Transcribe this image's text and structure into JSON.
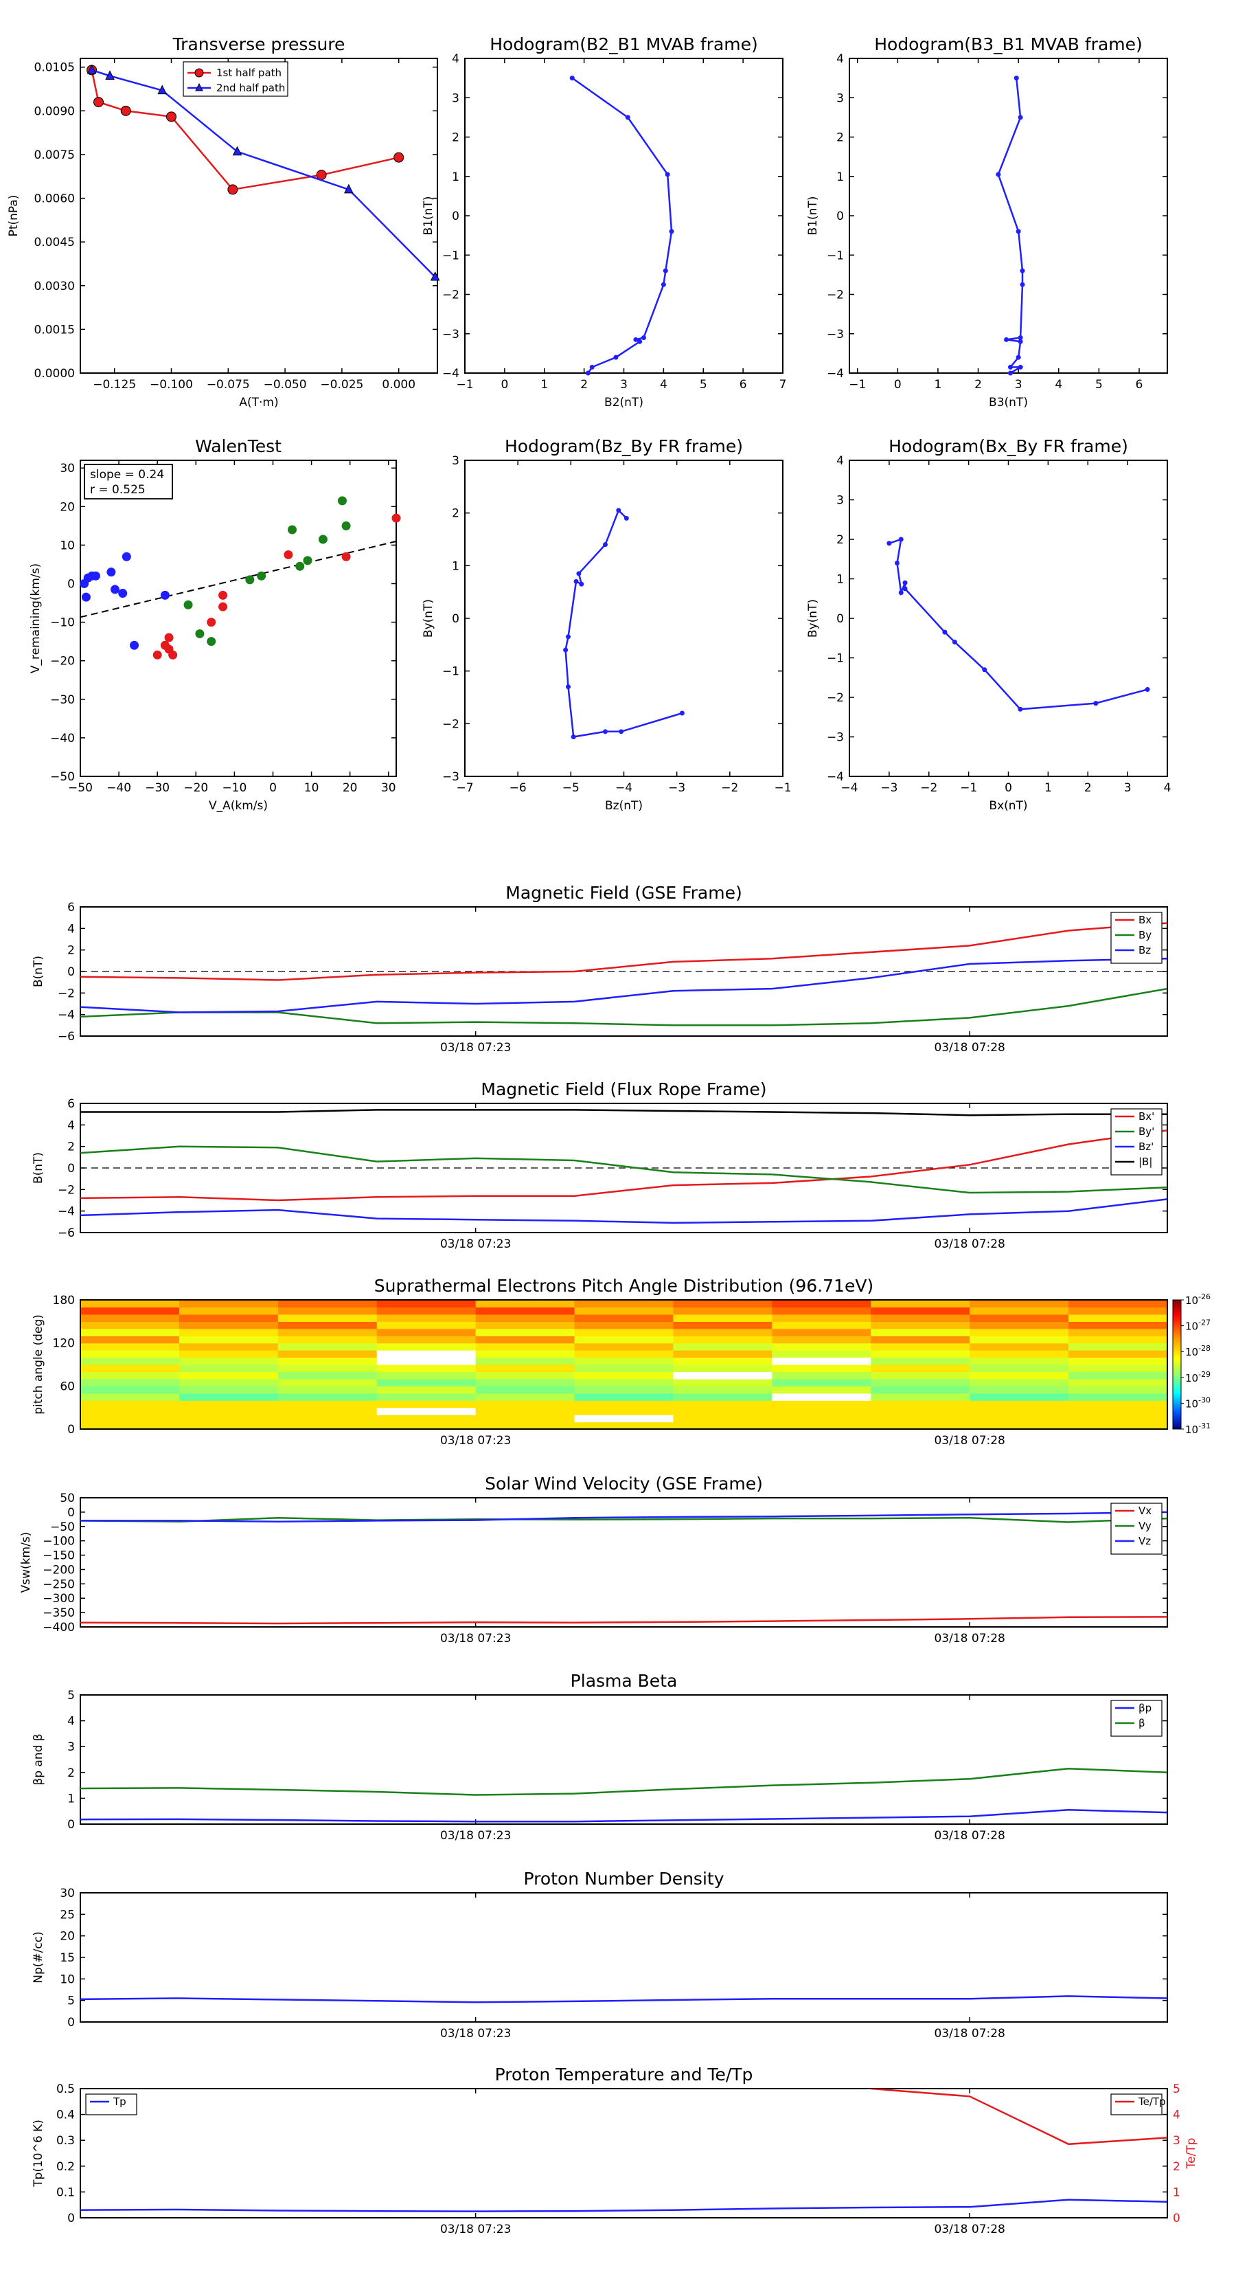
{
  "chart_data": [
    {
      "id": "transverse_pressure",
      "type": "line",
      "title": "Transverse pressure",
      "xlabel": "A(T·m)",
      "ylabel": "Pt(nPa)",
      "xlim": [
        -0.14,
        0.017
      ],
      "ylim": [
        0,
        0.0108
      ],
      "xticks": [
        -0.125,
        -0.1,
        -0.075,
        -0.05,
        -0.025,
        0.0
      ],
      "xticklabels": [
        "−0.125",
        "−0.100",
        "−0.075",
        "−0.050",
        "−0.025",
        "0.000"
      ],
      "yticks": [
        0,
        0.0015,
        0.003,
        0.0045,
        0.006,
        0.0075,
        0.009,
        0.0105
      ],
      "yticklabels": [
        "0.0000",
        "0.0015",
        "0.0030",
        "0.0045",
        "0.0060",
        "0.0075",
        "0.0090",
        "0.0105"
      ],
      "legend": "top-center",
      "series": [
        {
          "name": "1st half path",
          "color": "#e41a1c",
          "marker": "circle",
          "x": [
            -0.135,
            -0.132,
            -0.12,
            -0.1,
            -0.073,
            -0.034,
            0.0
          ],
          "y": [
            0.0104,
            0.0093,
            0.009,
            0.0088,
            0.0063,
            0.0068,
            0.0074
          ]
        },
        {
          "name": "2nd half path",
          "color": "#1f1fff",
          "marker": "triangle",
          "x": [
            -0.135,
            -0.127,
            -0.104,
            -0.071,
            -0.022,
            0.016
          ],
          "y": [
            0.0104,
            0.0102,
            0.0097,
            0.0076,
            0.0063,
            0.0033
          ]
        }
      ]
    },
    {
      "id": "hodogram_b2_b1",
      "type": "line",
      "title": "Hodogram(B2_B1 MVAB frame)",
      "xlabel": "B2(nT)",
      "ylabel": "B1(nT)",
      "xlim": [
        -1,
        7
      ],
      "ylim": [
        -4,
        4
      ],
      "xticks": [
        -1,
        0,
        1,
        2,
        3,
        4,
        5,
        6,
        7
      ],
      "yticks": [
        -4,
        -3,
        -2,
        -1,
        0,
        1,
        2,
        3,
        4
      ],
      "series": [
        {
          "color": "#1f1fff",
          "x": [
            1.7,
            3.1,
            4.1,
            4.2,
            4.05,
            4.0,
            3.5,
            3.3,
            3.4,
            2.8,
            2.2,
            2.1
          ],
          "y": [
            3.5,
            2.5,
            1.05,
            -0.4,
            -1.4,
            -1.75,
            -3.1,
            -3.15,
            -3.2,
            -3.6,
            -3.85,
            -4.0
          ]
        }
      ]
    },
    {
      "id": "hodogram_b3_b1",
      "type": "line",
      "title": "Hodogram(B3_B1 MVAB frame)",
      "xlabel": "B3(nT)",
      "ylabel": "B1(nT)",
      "xlim": [
        -1.2,
        6.7
      ],
      "ylim": [
        -4,
        4
      ],
      "xticks": [
        -1,
        0,
        1,
        2,
        3,
        4,
        5,
        6
      ],
      "yticks": [
        -4,
        -3,
        -2,
        -1,
        0,
        1,
        2,
        3,
        4
      ],
      "series": [
        {
          "color": "#1f1fff",
          "x": [
            2.95,
            3.05,
            2.5,
            3.0,
            3.1,
            3.1,
            3.05,
            2.7,
            3.05,
            3.0,
            2.8,
            3.05,
            2.8
          ],
          "y": [
            3.5,
            2.5,
            1.05,
            -0.4,
            -1.4,
            -1.75,
            -3.1,
            -3.15,
            -3.2,
            -3.6,
            -3.85,
            -3.85,
            -4.0
          ]
        }
      ]
    },
    {
      "id": "walen_test",
      "type": "scatter",
      "title": "WalenTest",
      "xlabel": "V_A(km/s)",
      "ylabel": "V_remaining(km/s)",
      "xlim": [
        -50,
        32
      ],
      "ylim": [
        -50,
        32
      ],
      "xticks": [
        -50,
        -40,
        -30,
        -20,
        -10,
        0,
        10,
        20,
        30
      ],
      "yticks": [
        -50,
        -40,
        -30,
        -20,
        -10,
        0,
        10,
        20,
        30
      ],
      "annotation": [
        "slope = 0.24",
        "r = 0.525"
      ],
      "fit": {
        "slope": 0.24,
        "intercept": 3.3
      },
      "series": [
        {
          "color": "#1f1fff",
          "x": [
            -49,
            -48,
            -47,
            -46,
            -48.5,
            -42,
            -41,
            -38,
            -39,
            -36,
            -28
          ],
          "y": [
            0,
            1.5,
            2,
            2,
            -3.5,
            3,
            -1.5,
            7,
            -2.5,
            -16,
            -3
          ]
        },
        {
          "color": "#e41a1c",
          "x": [
            -30,
            -28,
            -27,
            -27,
            -26,
            -16,
            -13,
            -13,
            4,
            19,
            32
          ],
          "y": [
            -18.5,
            -16,
            -14,
            -17,
            -18.5,
            -10,
            -6,
            -3,
            7.5,
            7,
            17
          ]
        },
        {
          "color": "#1a801a",
          "x": [
            -22,
            -19,
            -16,
            -6,
            -3,
            5,
            7,
            9,
            13,
            18,
            19
          ],
          "y": [
            -5.5,
            -13,
            -15,
            1,
            2,
            14,
            4.5,
            6,
            11.5,
            21.5,
            15
          ]
        }
      ]
    },
    {
      "id": "hodogram_bz_by",
      "type": "line",
      "title": "Hodogram(Bz_By FR frame)",
      "xlabel": "Bz(nT)",
      "ylabel": "By(nT)",
      "xlim": [
        -7,
        -1
      ],
      "ylim": [
        -3,
        3
      ],
      "xticks": [
        -7,
        -6,
        -5,
        -4,
        -3,
        -2,
        -1
      ],
      "yticks": [
        -3,
        -2,
        -1,
        0,
        1,
        2,
        3
      ],
      "series": [
        {
          "color": "#1f1fff",
          "x": [
            -3.95,
            -4.1,
            -4.35,
            -4.85,
            -4.8,
            -4.9,
            -5.05,
            -5.1,
            -5.05,
            -4.95,
            -4.35,
            -4.05,
            -2.9
          ],
          "y": [
            1.9,
            2.05,
            1.4,
            0.85,
            0.65,
            0.7,
            -0.35,
            -0.6,
            -1.3,
            -2.25,
            -2.15,
            -2.15,
            -1.8
          ]
        }
      ]
    },
    {
      "id": "hodogram_bx_by",
      "type": "line",
      "title": "Hodogram(Bx_By FR frame)",
      "xlabel": "Bx(nT)",
      "ylabel": "By(nT)",
      "xlim": [
        -4,
        4
      ],
      "ylim": [
        -4,
        4
      ],
      "xticks": [
        -4,
        -3,
        -2,
        -1,
        0,
        1,
        2,
        3,
        4
      ],
      "yticks": [
        -4,
        -3,
        -2,
        -1,
        0,
        1,
        2,
        3,
        4
      ],
      "series": [
        {
          "color": "#1f1fff",
          "x": [
            -3.0,
            -2.7,
            -2.8,
            -2.7,
            -2.6,
            -2.6,
            -1.6,
            -1.35,
            -0.6,
            0.3,
            2.2,
            3.5
          ],
          "y": [
            1.9,
            2.0,
            1.4,
            0.65,
            0.9,
            0.75,
            -0.35,
            -0.6,
            -1.3,
            -2.3,
            -2.15,
            -1.8
          ]
        }
      ]
    },
    {
      "id": "mag_gse",
      "type": "line",
      "title": "Magnetic Field (GSE Frame)",
      "ylabel": "B(nT)",
      "xlim": [
        0,
        11
      ],
      "ylim": [
        -6,
        6
      ],
      "yticks": [
        -6,
        -4,
        -2,
        0,
        2,
        4,
        6
      ],
      "xtick_positions": [
        4,
        9
      ],
      "xticklabels": [
        "03/18 07:23",
        "03/18 07:28"
      ],
      "zero_line": true,
      "legend": "top-right",
      "x": [
        0,
        1,
        2,
        3,
        4,
        5,
        6,
        7,
        8,
        9,
        10,
        11
      ],
      "series": [
        {
          "name": "Bx",
          "color": "#e41a1c",
          "values": [
            -0.5,
            -0.6,
            -0.8,
            -0.3,
            -0.1,
            0.0,
            0.9,
            1.2,
            1.8,
            2.4,
            3.8,
            4.5
          ]
        },
        {
          "name": "By",
          "color": "#1a801a",
          "values": [
            -4.2,
            -3.8,
            -3.8,
            -4.8,
            -4.7,
            -4.8,
            -5.0,
            -5.0,
            -4.8,
            -4.3,
            -3.2,
            -1.6
          ]
        },
        {
          "name": "Bz",
          "color": "#1f1fff",
          "values": [
            -3.3,
            -3.8,
            -3.7,
            -2.8,
            -3.0,
            -2.8,
            -1.8,
            -1.6,
            -0.6,
            0.7,
            1.0,
            1.2
          ]
        }
      ]
    },
    {
      "id": "mag_fr",
      "type": "line",
      "title": "Magnetic Field (Flux Rope Frame)",
      "ylabel": "B(nT)",
      "xlim": [
        0,
        11
      ],
      "ylim": [
        -6,
        6
      ],
      "yticks": [
        -6,
        -4,
        -2,
        0,
        2,
        4,
        6
      ],
      "xtick_positions": [
        4,
        9
      ],
      "xticklabels": [
        "03/18 07:23",
        "03/18 07:28"
      ],
      "zero_line": true,
      "legend": "top-right",
      "x": [
        0,
        1,
        2,
        3,
        4,
        5,
        6,
        7,
        8,
        9,
        10,
        11
      ],
      "series": [
        {
          "name": "Bx'",
          "color": "#e41a1c",
          "values": [
            -2.8,
            -2.7,
            -3.0,
            -2.7,
            -2.6,
            -2.6,
            -1.6,
            -1.4,
            -0.8,
            0.3,
            2.2,
            3.5
          ]
        },
        {
          "name": "By'",
          "color": "#1a801a",
          "values": [
            1.4,
            2.0,
            1.9,
            0.6,
            0.9,
            0.7,
            -0.4,
            -0.6,
            -1.3,
            -2.3,
            -2.2,
            -1.8
          ]
        },
        {
          "name": "Bz'",
          "color": "#1f1fff",
          "values": [
            -4.4,
            -4.1,
            -3.9,
            -4.7,
            -4.8,
            -4.9,
            -5.1,
            -5.0,
            -4.9,
            -4.3,
            -4.0,
            -2.9
          ]
        },
        {
          "name": "|B|",
          "color": "#000000",
          "values": [
            5.2,
            5.2,
            5.2,
            5.4,
            5.4,
            5.4,
            5.3,
            5.2,
            5.1,
            4.9,
            5.0,
            5.0
          ]
        }
      ]
    },
    {
      "id": "pad",
      "type": "heatmap",
      "title": "Suprathermal Electrons Pitch Angle Distribution (96.71eV)",
      "ylabel": "pitch angle (deg)",
      "xlim": [
        0,
        11
      ],
      "ylim": [
        0,
        180
      ],
      "yticks": [
        0,
        60,
        120,
        180
      ],
      "xtick_positions": [
        4,
        9
      ],
      "xticklabels": [
        "03/18 07:23",
        "03/18 07:28"
      ],
      "colorbar_ticks": [
        "10-26",
        "10-27",
        "10-28",
        "10-29",
        "10-30",
        "10-31"
      ],
      "colorbar_range_log10": [
        -31,
        -26
      ],
      "columns": 11,
      "rows": 18
    },
    {
      "id": "sw_velocity",
      "type": "line",
      "title": "Solar Wind Velocity (GSE Frame)",
      "ylabel": "Vsw(km/s)",
      "xlim": [
        0,
        11
      ],
      "ylim": [
        -400,
        50
      ],
      "yticks": [
        -400,
        -350,
        -300,
        -250,
        -200,
        -150,
        -100,
        -50,
        0,
        50
      ],
      "xtick_positions": [
        4,
        9
      ],
      "xticklabels": [
        "03/18 07:23",
        "03/18 07:28"
      ],
      "legend": "top-right",
      "x": [
        0,
        1,
        2,
        3,
        4,
        5,
        6,
        7,
        8,
        9,
        10,
        11
      ],
      "series": [
        {
          "name": "Vx",
          "color": "#e41a1c",
          "values": [
            -385,
            -386,
            -388,
            -386,
            -384,
            -385,
            -383,
            -380,
            -376,
            -372,
            -366,
            -365
          ]
        },
        {
          "name": "Vy",
          "color": "#1a801a",
          "values": [
            -30,
            -33,
            -20,
            -28,
            -25,
            -26,
            -25,
            -22,
            -22,
            -20,
            -35,
            -22
          ]
        },
        {
          "name": "Vz",
          "color": "#1f1fff",
          "values": [
            -30,
            -30,
            -33,
            -30,
            -28,
            -20,
            -17,
            -15,
            -12,
            -8,
            -5,
            0
          ]
        }
      ]
    },
    {
      "id": "plasma_beta",
      "type": "line",
      "title": "Plasma Beta",
      "ylabel": "βp and β",
      "xlim": [
        0,
        11
      ],
      "ylim": [
        0,
        5
      ],
      "yticks": [
        0,
        1,
        2,
        3,
        4,
        5
      ],
      "xtick_positions": [
        4,
        9
      ],
      "xticklabels": [
        "03/18 07:23",
        "03/18 07:28"
      ],
      "legend": "top-right",
      "x": [
        0,
        1,
        2,
        3,
        4,
        5,
        6,
        7,
        8,
        9,
        10,
        11
      ],
      "series": [
        {
          "name": "βp",
          "color": "#1f1fff",
          "values": [
            0.18,
            0.19,
            0.16,
            0.12,
            0.1,
            0.1,
            0.15,
            0.2,
            0.25,
            0.3,
            0.55,
            0.45
          ]
        },
        {
          "name": "β",
          "color": "#1a801a",
          "values": [
            1.38,
            1.4,
            1.33,
            1.25,
            1.13,
            1.18,
            1.35,
            1.5,
            1.6,
            1.75,
            2.15,
            2.0
          ]
        }
      ]
    },
    {
      "id": "proton_density",
      "type": "line",
      "title": "Proton Number Density",
      "ylabel": "Np(#/cc)",
      "xlim": [
        0,
        11
      ],
      "ylim": [
        0,
        30
      ],
      "yticks": [
        0,
        5,
        10,
        15,
        20,
        25,
        30
      ],
      "xtick_positions": [
        4,
        9
      ],
      "xticklabels": [
        "03/18 07:23",
        "03/18 07:28"
      ],
      "x": [
        0,
        1,
        2,
        3,
        4,
        5,
        6,
        7,
        8,
        9,
        10,
        11
      ],
      "series": [
        {
          "color": "#1f1fff",
          "values": [
            5.3,
            5.5,
            5.2,
            4.9,
            4.6,
            4.8,
            5.1,
            5.4,
            5.4,
            5.4,
            6.0,
            5.5
          ]
        }
      ]
    },
    {
      "id": "proton_temperature",
      "type": "line",
      "title": "Proton Temperature and Te/Tp",
      "ylabel": "Tp(10^6 K)",
      "ylabel_right": "Te/Tp",
      "xlim": [
        0,
        11
      ],
      "ylim": [
        0,
        0.5
      ],
      "ylim_right": [
        0,
        5
      ],
      "yticks": [
        0,
        0.1,
        0.2,
        0.3,
        0.4,
        0.5
      ],
      "yticks_right": [
        0,
        1,
        2,
        3,
        4,
        5
      ],
      "xtick_positions": [
        4,
        9
      ],
      "xticklabels": [
        "03/18 07:23",
        "03/18 07:28"
      ],
      "x": [
        0,
        1,
        2,
        3,
        4,
        5,
        6,
        7,
        8,
        9,
        10,
        11
      ],
      "series": [
        {
          "name": "Tp",
          "color": "#1f1fff",
          "axis": "left",
          "legend": "top-left",
          "values": [
            0.03,
            0.032,
            0.028,
            0.026,
            0.025,
            0.026,
            0.03,
            0.036,
            0.04,
            0.042,
            0.07,
            0.062
          ]
        },
        {
          "name": "Te/Tp",
          "color": "#e41a1c",
          "axis": "right",
          "legend": "top-right",
          "values": [
            null,
            null,
            null,
            null,
            null,
            null,
            null,
            5.6,
            5.0,
            4.7,
            2.85,
            3.1
          ]
        }
      ]
    }
  ]
}
